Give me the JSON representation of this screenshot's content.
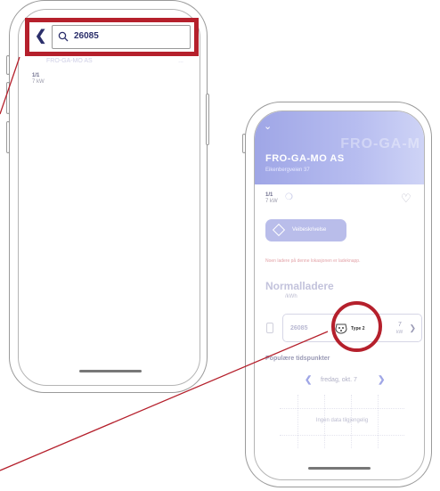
{
  "left_screen": {
    "search": {
      "value": "26085"
    },
    "result": {
      "name_faded": "FRO-GA-MO AS",
      "right_faded": "..."
    },
    "stats": {
      "available": "1/1",
      "power": "7 kW"
    }
  },
  "right_screen": {
    "station": {
      "name": "FRO-GA-MO AS",
      "address": "Eikenbergveien 37",
      "ghost": "FRO-GA-M"
    },
    "stats": {
      "available": "1/1",
      "power": "7 kW"
    },
    "route_button": "Veibeskrivelse",
    "warning": "Noen ladere på denne lokasjonen er ladeknapp.",
    "charger_type": {
      "title": "Normalladere",
      "price": "/kWh"
    },
    "connector": {
      "id": "26085",
      "type": "Type 2",
      "kw_value": "7",
      "kw_unit": "kW"
    },
    "popular_times": {
      "title": "Populære tidspunkter",
      "date": "fredag, okt. 7",
      "empty": "Ingen data tilgjengelig"
    }
  },
  "colors": {
    "accent": "#b5202c",
    "brand": "#9fa6e6",
    "navy": "#2b2f6b"
  }
}
